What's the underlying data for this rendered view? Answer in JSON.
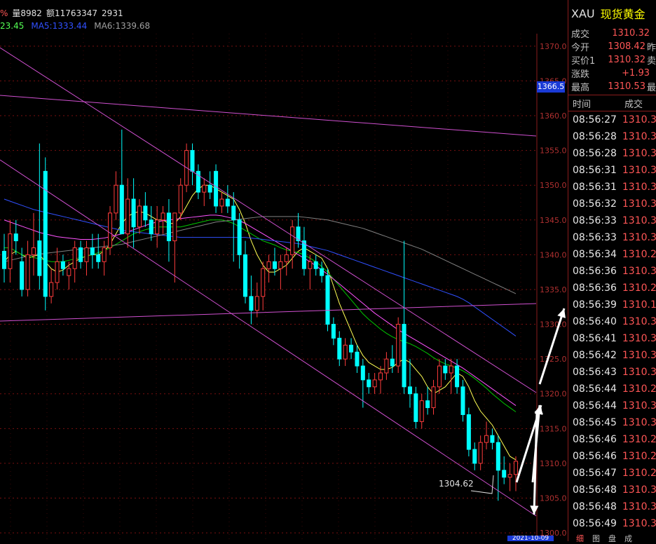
{
  "info_bar": {
    "percent_sign": "%",
    "volume": "量8982",
    "amount": "额11763347",
    "open_interest": "2931"
  },
  "ma_bar": {
    "ma_first": "23.45",
    "ma5": "MA5:1333.44",
    "ma6": "MA6:1339.68"
  },
  "colors": {
    "up": "#ff3c3c",
    "down": "#00ffff",
    "ma_white": "#ffffff",
    "ma_yellow": "#ffff54",
    "ma_magenta": "#ff54ff",
    "ma_green": "#00c800",
    "ma_blue": "#3050ff",
    "ma_grey": "#808080",
    "trendline": "#d050d0"
  },
  "current_price_tag": "1366.5",
  "low_annotation": "1304.62",
  "date_tag": "2021-10-09",
  "side_panel": {
    "symbol": "XAU",
    "name": "现货黄金",
    "quotes": [
      {
        "label": "成交",
        "value": "1310.32",
        "color": "red",
        "label2": ""
      },
      {
        "label": "今开",
        "value": "1308.42",
        "color": "red",
        "label2": "昨"
      },
      {
        "label": "买价1",
        "value": "1310.32",
        "color": "red",
        "label2": "卖"
      },
      {
        "label": "涨跌",
        "value": "+1.93",
        "color": "red",
        "label2": ""
      },
      {
        "label": "最高",
        "value": "1310.53",
        "color": "red",
        "label2": "最"
      }
    ],
    "ticks_header": {
      "time": "时间",
      "price": "成交"
    },
    "ticks": [
      {
        "time": "08:56:27",
        "price": "1310.3"
      },
      {
        "time": "08:56:28",
        "price": "1310.3"
      },
      {
        "time": "08:56:28",
        "price": "1310.3"
      },
      {
        "time": "08:56:31",
        "price": "1310.3"
      },
      {
        "time": "08:56:31",
        "price": "1310.3"
      },
      {
        "time": "08:56:32",
        "price": "1310.3"
      },
      {
        "time": "08:56:33",
        "price": "1310.3"
      },
      {
        "time": "08:56:33",
        "price": "1310.3"
      },
      {
        "time": "08:56:34",
        "price": "1310.2"
      },
      {
        "time": "08:56:36",
        "price": "1310.3"
      },
      {
        "time": "08:56:36",
        "price": "1310.2"
      },
      {
        "time": "08:56:39",
        "price": "1310.1"
      },
      {
        "time": "08:56:40",
        "price": "1310.3"
      },
      {
        "time": "08:56:41",
        "price": "1310.3"
      },
      {
        "time": "08:56:42",
        "price": "1310.3"
      },
      {
        "time": "08:56:43",
        "price": "1310.3"
      },
      {
        "time": "08:56:44",
        "price": "1310.2"
      },
      {
        "time": "08:56:44",
        "price": "1310.3"
      },
      {
        "time": "08:56:45",
        "price": "1310.3"
      },
      {
        "time": "08:56:46",
        "price": "1310.2"
      },
      {
        "time": "08:56:46",
        "price": "1310.2"
      },
      {
        "time": "08:56:47",
        "price": "1310.2"
      },
      {
        "time": "08:56:48",
        "price": "1310.3"
      },
      {
        "time": "08:56:48",
        "price": "1310.3"
      },
      {
        "time": "08:56:49",
        "price": "1310.3"
      }
    ],
    "bottom_tabs": [
      "细",
      "图",
      "盘",
      "成"
    ]
  },
  "chart_data": {
    "type": "candlestick",
    "y_axis_ticks": [
      "1370.0",
      "1365.0",
      "1360.0",
      "1355.0",
      "1350.0",
      "1345.0",
      "1340.0",
      "1335.0",
      "1330.0",
      "1325.0",
      "1320.0",
      "1315.0",
      "1310.0",
      "1305.0",
      "1300.0"
    ],
    "ylim": [
      1299,
      1372
    ],
    "grid": true,
    "candles": [
      {
        "o": 1340.5,
        "h": 1343,
        "l": 1336,
        "c": 1338
      },
      {
        "o": 1338,
        "h": 1345,
        "l": 1336,
        "c": 1343
      },
      {
        "o": 1343,
        "h": 1345,
        "l": 1340,
        "c": 1342
      },
      {
        "o": 1339,
        "h": 1341,
        "l": 1334,
        "c": 1335
      },
      {
        "o": 1335,
        "h": 1342,
        "l": 1334,
        "c": 1340
      },
      {
        "o": 1340,
        "h": 1346,
        "l": 1337,
        "c": 1341
      },
      {
        "o": 1342,
        "h": 1356,
        "l": 1335,
        "c": 1337
      },
      {
        "o": 1352,
        "h": 1354,
        "l": 1332,
        "c": 1334
      },
      {
        "o": 1334,
        "h": 1338,
        "l": 1333,
        "c": 1336
      },
      {
        "o": 1336,
        "h": 1341,
        "l": 1335,
        "c": 1339
      },
      {
        "o": 1339,
        "h": 1340,
        "l": 1337,
        "c": 1338
      },
      {
        "o": 1337,
        "h": 1339,
        "l": 1335,
        "c": 1338
      },
      {
        "o": 1338,
        "h": 1342,
        "l": 1336,
        "c": 1341
      },
      {
        "o": 1341,
        "h": 1342,
        "l": 1338,
        "c": 1339
      },
      {
        "o": 1339,
        "h": 1342,
        "l": 1337,
        "c": 1341
      },
      {
        "o": 1341,
        "h": 1343,
        "l": 1338,
        "c": 1340
      },
      {
        "o": 1340,
        "h": 1343,
        "l": 1338,
        "c": 1339
      },
      {
        "o": 1339,
        "h": 1342,
        "l": 1337,
        "c": 1341
      },
      {
        "o": 1341,
        "h": 1347,
        "l": 1340,
        "c": 1346
      },
      {
        "o": 1346,
        "h": 1352,
        "l": 1345,
        "c": 1350
      },
      {
        "o": 1350,
        "h": 1358,
        "l": 1343,
        "c": 1343
      },
      {
        "o": 1343,
        "h": 1351,
        "l": 1341,
        "c": 1348
      },
      {
        "o": 1348,
        "h": 1351,
        "l": 1341,
        "c": 1344
      },
      {
        "o": 1344,
        "h": 1348,
        "l": 1343,
        "c": 1347
      },
      {
        "o": 1347,
        "h": 1349,
        "l": 1344,
        "c": 1345
      },
      {
        "o": 1345,
        "h": 1347,
        "l": 1342,
        "c": 1343
      },
      {
        "o": 1343,
        "h": 1347,
        "l": 1341,
        "c": 1345
      },
      {
        "o": 1345,
        "h": 1347,
        "l": 1343,
        "c": 1346
      },
      {
        "o": 1346,
        "h": 1348,
        "l": 1339,
        "c": 1342
      },
      {
        "o": 1342,
        "h": 1346,
        "l": 1336,
        "c": 1346
      },
      {
        "o": 1346,
        "h": 1351,
        "l": 1345,
        "c": 1350
      },
      {
        "o": 1350,
        "h": 1356,
        "l": 1349,
        "c": 1355
      },
      {
        "o": 1355,
        "h": 1356,
        "l": 1350,
        "c": 1352
      },
      {
        "o": 1352,
        "h": 1353,
        "l": 1348,
        "c": 1349
      },
      {
        "o": 1349,
        "h": 1351,
        "l": 1347,
        "c": 1350
      },
      {
        "o": 1350,
        "h": 1352,
        "l": 1348,
        "c": 1349
      },
      {
        "o": 1352,
        "h": 1353,
        "l": 1346,
        "c": 1347
      },
      {
        "o": 1347,
        "h": 1349,
        "l": 1346,
        "c": 1348
      },
      {
        "o": 1348,
        "h": 1350,
        "l": 1346,
        "c": 1347
      },
      {
        "o": 1347,
        "h": 1349,
        "l": 1339,
        "c": 1345
      },
      {
        "o": 1345,
        "h": 1346,
        "l": 1338,
        "c": 1340
      },
      {
        "o": 1340,
        "h": 1342,
        "l": 1333,
        "c": 1334
      },
      {
        "o": 1334,
        "h": 1337,
        "l": 1330,
        "c": 1332
      },
      {
        "o": 1332,
        "h": 1336,
        "l": 1331,
        "c": 1334
      },
      {
        "o": 1334,
        "h": 1339,
        "l": 1332,
        "c": 1338
      },
      {
        "o": 1338,
        "h": 1340,
        "l": 1336,
        "c": 1339
      },
      {
        "o": 1339,
        "h": 1341,
        "l": 1337,
        "c": 1338
      },
      {
        "o": 1338,
        "h": 1340,
        "l": 1335,
        "c": 1339
      },
      {
        "o": 1339,
        "h": 1341,
        "l": 1337,
        "c": 1340
      },
      {
        "o": 1340,
        "h": 1345,
        "l": 1338,
        "c": 1344
      },
      {
        "o": 1344,
        "h": 1346,
        "l": 1341,
        "c": 1342
      },
      {
        "o": 1342,
        "h": 1344,
        "l": 1337,
        "c": 1338
      },
      {
        "o": 1338,
        "h": 1340,
        "l": 1335,
        "c": 1339
      },
      {
        "o": 1339,
        "h": 1340,
        "l": 1337,
        "c": 1338
      },
      {
        "o": 1338,
        "h": 1339,
        "l": 1336,
        "c": 1337
      },
      {
        "o": 1337,
        "h": 1338,
        "l": 1329,
        "c": 1330
      },
      {
        "o": 1330,
        "h": 1331,
        "l": 1327,
        "c": 1328
      },
      {
        "o": 1328,
        "h": 1329,
        "l": 1324,
        "c": 1325
      },
      {
        "o": 1325,
        "h": 1328,
        "l": 1324,
        "c": 1327
      },
      {
        "o": 1327,
        "h": 1328,
        "l": 1325,
        "c": 1326
      },
      {
        "o": 1326,
        "h": 1327,
        "l": 1323,
        "c": 1324
      },
      {
        "o": 1324,
        "h": 1325,
        "l": 1318,
        "c": 1322
      },
      {
        "o": 1322,
        "h": 1323,
        "l": 1320,
        "c": 1321
      },
      {
        "o": 1321,
        "h": 1323,
        "l": 1320,
        "c": 1322
      },
      {
        "o": 1322,
        "h": 1324,
        "l": 1320,
        "c": 1323
      },
      {
        "o": 1323,
        "h": 1326,
        "l": 1322,
        "c": 1325
      },
      {
        "o": 1325,
        "h": 1327,
        "l": 1323,
        "c": 1324
      },
      {
        "o": 1324,
        "h": 1331,
        "l": 1323,
        "c": 1330
      },
      {
        "o": 1330,
        "h": 1342,
        "l": 1320,
        "c": 1321
      },
      {
        "o": 1321,
        "h": 1325,
        "l": 1318,
        "c": 1320
      },
      {
        "o": 1320,
        "h": 1321,
        "l": 1315,
        "c": 1316
      },
      {
        "o": 1316,
        "h": 1320,
        "l": 1315,
        "c": 1319
      },
      {
        "o": 1319,
        "h": 1321,
        "l": 1317,
        "c": 1318
      },
      {
        "o": 1318,
        "h": 1322,
        "l": 1317,
        "c": 1321
      },
      {
        "o": 1321,
        "h": 1325,
        "l": 1320,
        "c": 1324
      },
      {
        "o": 1324,
        "h": 1325,
        "l": 1322,
        "c": 1323
      },
      {
        "o": 1323,
        "h": 1325,
        "l": 1320,
        "c": 1324
      },
      {
        "o": 1324,
        "h": 1325,
        "l": 1320,
        "c": 1321
      },
      {
        "o": 1321,
        "h": 1322,
        "l": 1316,
        "c": 1317
      },
      {
        "o": 1317,
        "h": 1318,
        "l": 1311,
        "c": 1312
      },
      {
        "o": 1312,
        "h": 1313,
        "l": 1309,
        "c": 1310
      },
      {
        "o": 1310,
        "h": 1314,
        "l": 1309,
        "c": 1313
      },
      {
        "o": 1313,
        "h": 1316,
        "l": 1312,
        "c": 1314
      },
      {
        "o": 1314,
        "h": 1315,
        "l": 1312,
        "c": 1313
      },
      {
        "o": 1313,
        "h": 1314,
        "l": 1304.62,
        "c": 1309
      },
      {
        "o": 1309,
        "h": 1311,
        "l": 1307,
        "c": 1308
      },
      {
        "o": 1308,
        "h": 1310,
        "l": 1306,
        "c": 1308.4
      },
      {
        "o": 1308.4,
        "h": 1311,
        "l": 1306,
        "c": 1310.3
      }
    ],
    "moving_averages": [
      {
        "color_key": "ma_yellow",
        "values": [
          1339,
          1340,
          1340.5,
          1340,
          1339.5,
          1339.8,
          1340,
          1339,
          1338,
          1337.5,
          1337.8,
          1338.5,
          1339,
          1339.5,
          1339.8,
          1340,
          1340,
          1340.5,
          1341.5,
          1343,
          1344.5,
          1345.5,
          1346,
          1346.2,
          1346,
          1345.5,
          1345,
          1345,
          1344.5,
          1344.5,
          1345.5,
          1347,
          1348.5,
          1349.5,
          1350,
          1350,
          1349.5,
          1349,
          1348.5,
          1348,
          1346.5,
          1344.5,
          1342,
          1340,
          1338.5,
          1337.5,
          1337.5,
          1338,
          1338.5,
          1339.5,
          1340.5,
          1341,
          1340.5,
          1340,
          1339.5,
          1338,
          1335.5,
          1333,
          1331,
          1329,
          1327,
          1325.5,
          1324.5,
          1324,
          1323.5,
          1323.5,
          1323.8,
          1324.5,
          1325,
          1324.5,
          1323.5,
          1322.5,
          1321,
          1320,
          1320.5,
          1321,
          1322,
          1323,
          1322.5,
          1321,
          1319,
          1317.5,
          1316.5,
          1315.5,
          1314,
          1312.5,
          1311,
          1310.5
        ]
      },
      {
        "color_key": "ma_green",
        "values": [
          1341,
          1341,
          1340.5,
          1340,
          1339.8,
          1339.6,
          1339.4,
          1339.2,
          1339,
          1339,
          1339,
          1339.2,
          1339.4,
          1339.6,
          1339.8,
          1340,
          1340.3,
          1340.6,
          1341,
          1341.5,
          1342,
          1342.5,
          1343,
          1343.3,
          1343.6,
          1343.8,
          1344,
          1344,
          1344,
          1344,
          1344,
          1344.2,
          1344.4,
          1344.6,
          1344.8,
          1345,
          1345,
          1345,
          1344.8,
          1344.5,
          1344,
          1343.5,
          1343,
          1342.5,
          1342,
          1341.7,
          1341.4,
          1341,
          1340.7,
          1340.5,
          1340.3,
          1340,
          1339.5,
          1339,
          1338.3,
          1337.5,
          1336.5,
          1335.5,
          1334.5,
          1333.5,
          1332.5,
          1331.5,
          1330.7,
          1330,
          1329.3,
          1328.7,
          1328.2,
          1327.8,
          1327.5,
          1327.2,
          1326.8,
          1326.3,
          1325.8,
          1325.2,
          1324.7,
          1324.3,
          1324,
          1323.7,
          1323.3,
          1322.8,
          1322.2,
          1321.5,
          1320.8,
          1320,
          1319.3,
          1318.6,
          1318,
          1317.4
        ]
      },
      {
        "color_key": "ma_magenta",
        "values": [
          1345,
          1344.7,
          1344.4,
          1344.1,
          1343.8,
          1343.5,
          1343.2,
          1343,
          1342.8,
          1342.6,
          1342.5,
          1342.4,
          1342.3,
          1342.2,
          1342.2,
          1342.2,
          1342.3,
          1342.4,
          1342.6,
          1342.8,
          1343,
          1343.3,
          1343.6,
          1343.9,
          1344.2,
          1344.5,
          1344.7,
          1344.9,
          1345,
          1345.1,
          1345.2,
          1345.3,
          1345.4,
          1345.5,
          1345.6,
          1345.7,
          1345.7,
          1345.6,
          1345.4,
          1345.2,
          1344.9,
          1344.5,
          1344,
          1343.5,
          1343,
          1342.5,
          1342,
          1341.5,
          1341,
          1340.5,
          1340,
          1339.5,
          1339,
          1338.4,
          1337.8,
          1337.2,
          1336.5,
          1335.8,
          1335.1,
          1334.4,
          1333.7,
          1333,
          1332.3,
          1331.6,
          1331,
          1330.4,
          1329.8,
          1329.2,
          1328.7,
          1328.2,
          1327.7,
          1327.2,
          1326.7,
          1326.2,
          1325.7,
          1325.2,
          1324.7,
          1324.2,
          1323.7,
          1323.1,
          1322.5,
          1321.9,
          1321.3,
          1320.7,
          1320.1,
          1319.5,
          1318.9,
          1318.3
        ]
      },
      {
        "color_key": "ma_blue",
        "values": [
          1348,
          1347.7,
          1347.4,
          1347.1,
          1346.8,
          1346.5,
          1346.3,
          1346.1,
          1345.9,
          1345.7,
          1345.5,
          1345.3,
          1345.1,
          1344.9,
          1344.7,
          1344.5,
          1344.3,
          1344.1,
          1343.9,
          1343.7,
          1343.5,
          1343.4,
          1343.3,
          1343.2,
          1343.1,
          1343,
          1342.9,
          1342.8,
          1342.7,
          1342.6,
          1342.5,
          1342.5,
          1342.5,
          1342.5,
          1342.5,
          1342.5,
          1342.5,
          1342.5,
          1342.5,
          1342.5,
          1342.5,
          1342.5,
          1342.4,
          1342.3,
          1342.2,
          1342.1,
          1342,
          1341.9,
          1341.8,
          1341.7,
          1341.6,
          1341.4,
          1341.2,
          1341,
          1340.8,
          1340.6,
          1340.3,
          1340,
          1339.7,
          1339.4,
          1339.1,
          1338.8,
          1338.5,
          1338.2,
          1337.9,
          1337.6,
          1337.3,
          1337,
          1336.7,
          1336.4,
          1336.1,
          1335.8,
          1335.5,
          1335.2,
          1334.9,
          1334.6,
          1334.3,
          1334,
          1333.6,
          1333.1,
          1332.5,
          1331.9,
          1331.3,
          1330.7,
          1330.1,
          1329.5,
          1328.9,
          1328.3
        ]
      },
      {
        "color_key": "ma_grey",
        "values": [
          1339,
          1339.2,
          1339.4,
          1339.6,
          1339.8,
          1340,
          1340.1,
          1340.2,
          1340.3,
          1340.4,
          1340.5,
          1340.6,
          1340.7,
          1340.8,
          1340.9,
          1341,
          1341.1,
          1341.2,
          1341.3,
          1341.4,
          1341.5,
          1341.7,
          1341.9,
          1342.1,
          1342.3,
          1342.5,
          1342.7,
          1342.9,
          1343.1,
          1343.3,
          1343.5,
          1343.7,
          1343.9,
          1344.1,
          1344.3,
          1344.5,
          1344.7,
          1344.8,
          1344.9,
          1345,
          1345.1,
          1345.2,
          1345.3,
          1345.4,
          1345.5,
          1345.5,
          1345.5,
          1345.5,
          1345.5,
          1345.5,
          1345.5,
          1345.4,
          1345.3,
          1345.2,
          1345.1,
          1345,
          1344.8,
          1344.6,
          1344.4,
          1344.2,
          1344,
          1343.8,
          1343.5,
          1343.2,
          1342.9,
          1342.6,
          1342.3,
          1342,
          1341.7,
          1341.4,
          1341.1,
          1340.8,
          1340.4,
          1340,
          1339.6,
          1339.2,
          1338.8,
          1338.4,
          1338,
          1337.6,
          1337.2,
          1336.8,
          1336.4,
          1336,
          1335.6,
          1335.2,
          1334.8,
          1334.4
        ]
      }
    ]
  }
}
